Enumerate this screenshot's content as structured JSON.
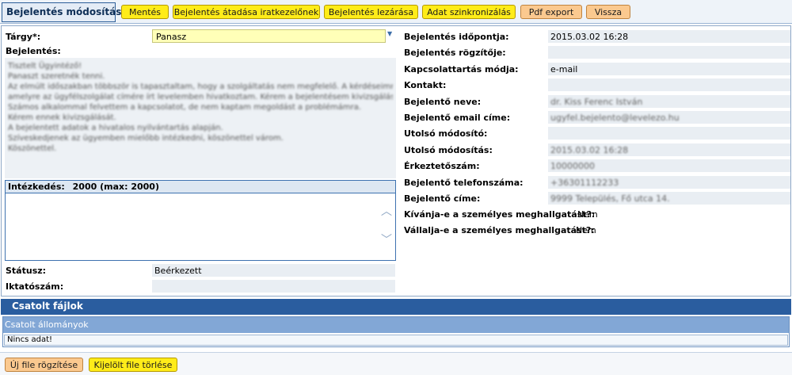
{
  "header": {
    "title": "Bejelentés módosítása",
    "buttons": {
      "save": "Mentés",
      "handover": "Bejelentés átadása iratkezelőnek",
      "close": "Bejelentés lezárása",
      "sync": "Adat szinkronizálás",
      "pdf": "Pdf export",
      "back": "Vissza"
    }
  },
  "form": {
    "subject_label": "Tárgy*:",
    "subject_value": "Panasz",
    "description_label": "Bejelentés:",
    "description_lines": [
      "Tisztelt Ügyintéző!",
      "",
      "Panaszt szeretnék tenni.",
      "",
      "Az elmúlt időszakban többször is tapasztaltam, hogy a szolgáltatás nem megfelelő. A kérdéseimre nem kaptam választ,",
      "amelyre az ügyfélszolgálat címére írt levelemben hivatkoztam. Kérem a bejelentésem kivizsgálását és érdemi válaszadást.",
      "Számos alkalommal felvettem a kapcsolatot, de nem kaptam megoldást a problémámra.",
      "Kérem ennek kivizsgálását.",
      "A bejelentett adatok a hivatalos nyilvántartás alapján.",
      "Szíveskedjenek az ügyemben mielőbb intézkedni, köszönettel várom.",
      "",
      "Köszönettel."
    ],
    "action_label": "Intézkedés:",
    "action_counter": "2000 (max: 2000)",
    "action_value": "",
    "status_label": "Státusz:",
    "status_value": "Beérkezett",
    "filing_label": "Iktatószám:",
    "filing_value": ""
  },
  "details": {
    "time_label": "Bejelentés időpontja:",
    "time_value": "2015.03.02 16:28",
    "recorder_label": "Bejelentés rögzítője:",
    "recorder_value": "",
    "contact_mode_label": "Kapcsolattartás módja:",
    "contact_mode_value": "e-mail",
    "contact_label": "Kontakt:",
    "contact_value": "",
    "reporter_name_label": "Bejelentő neve:",
    "reporter_name_value": "dr. Kiss Ferenc István",
    "reporter_email_label": "Bejelentő email címe:",
    "reporter_email_value": "ugyfel.bejelento@levelezo.hu",
    "last_modifier_label": "Utolsó módosító:",
    "last_modifier_value": "",
    "last_modified_label": "Utolsó módosítás:",
    "last_modified_value": "2015.03.02 16:28",
    "arrival_no_label": "Érkeztetőszám:",
    "arrival_no_value": "10000000",
    "phone_label": "Bejelentő telefonszáma:",
    "phone_value": "+36301112233",
    "address_label": "Bejelentő címe:",
    "address_value": "9999 Település, Fő utca 14.",
    "personal_hearing_label": "Kívánja-e a személyes meghallgatást?:",
    "personal_hearing_value": "Nem",
    "accept_hearing_label": "Vállalja-e a személyes meghallgatást?:",
    "accept_hearing_value": "Nem"
  },
  "attachments": {
    "header": "Csatolt fájlok",
    "column": "Csatolt állományok",
    "empty_text": "Nincs adat!",
    "new_file_button": "Új file rögzítése",
    "delete_file_button": "Kijelölt file törlése"
  }
}
